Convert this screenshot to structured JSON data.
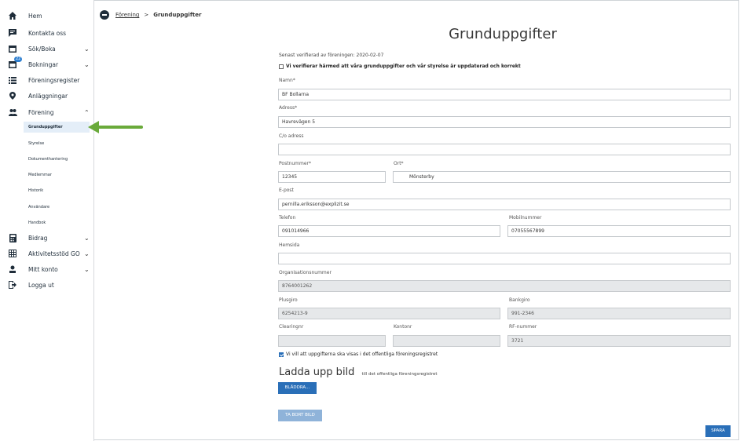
{
  "sidebar": {
    "items": [
      {
        "label": "Hem",
        "icon": "home-icon"
      },
      {
        "label": "Kontakta oss",
        "icon": "chat-icon"
      },
      {
        "label": "Sök/Boka",
        "icon": "calendar-icon",
        "chevron": "down"
      },
      {
        "label": "Bokningar",
        "icon": "calendar-badge-icon",
        "chevron": "down",
        "badge": "22"
      },
      {
        "label": "Föreningsregister",
        "icon": "list-icon"
      },
      {
        "label": "Anläggningar",
        "icon": "location-pin-icon"
      },
      {
        "label": "Förening",
        "icon": "people-icon",
        "chevron": "up"
      },
      {
        "label": "Bidrag",
        "icon": "calculator-icon",
        "chevron": "down"
      },
      {
        "label": "Aktivitetsstöd GO",
        "icon": "table-icon",
        "chevron": "down"
      },
      {
        "label": "Mitt konto",
        "icon": "user-icon",
        "chevron": "down"
      },
      {
        "label": "Logga ut",
        "icon": "logout-icon"
      }
    ],
    "subitems": [
      "Grunduppgifter",
      "Styrelse",
      "Dokumenthantering",
      "Medlemmar",
      "Historik",
      "Användare",
      "Handbok"
    ],
    "active_subitem": "Grunduppgifter"
  },
  "breadcrumb": {
    "parent": "Förening",
    "separator": ">",
    "current": "Grunduppgifter"
  },
  "form": {
    "title": "Grunduppgifter",
    "verified_text": "Senast verifierad av föreningen: 2020-02-07",
    "verify_checkbox_label": "Vi verifierar härmed att våra grunduppgifter och vår styrelse är uppdaterad och korrekt",
    "fields": {
      "namn": {
        "label": "Namn*",
        "value": "BF Bollarna"
      },
      "adress": {
        "label": "Adress*",
        "value": "Havrevägen 5"
      },
      "co_adress": {
        "label": "C/o adress",
        "value": ""
      },
      "postnummer": {
        "label": "Postnummer*",
        "value": "12345"
      },
      "ort": {
        "label": "Ort*",
        "value": "Mönsterby"
      },
      "epost": {
        "label": "E-post",
        "value": "pernilla.eriksson@explizit.se"
      },
      "telefon": {
        "label": "Telefon",
        "value": "091014966"
      },
      "mobil": {
        "label": "Mobilnummer",
        "value": "07055567899"
      },
      "hemsida": {
        "label": "Hemsida",
        "value": ""
      },
      "orgnr": {
        "label": "Organisationsnummer",
        "value": "8764001262"
      },
      "plusgiro": {
        "label": "Plusgiro",
        "value": "6254213-9"
      },
      "bankgiro": {
        "label": "Bankgiro",
        "value": "991-2346"
      },
      "clearingnr": {
        "label": "Clearingnr",
        "value": ""
      },
      "kontonr": {
        "label": "Kontonr",
        "value": ""
      },
      "rfnummer": {
        "label": "RF-nummer",
        "value": "3721"
      }
    },
    "public_checkbox_label": "Vi vill att uppgifterna ska visas i det offentliga föreningsregistret",
    "upload_title": "Ladda upp bild",
    "upload_subtitle": "till det offentliga föreningsregistret",
    "browse_button": "BLÄDDRA...",
    "remove_button": "TA BORT BILD",
    "save_button": "SPARA"
  },
  "colors": {
    "primary": "#2a6fb8",
    "primary_light": "#8fb3d9",
    "arrow": "#6aaa3a",
    "active_bg": "#e4eef8"
  }
}
